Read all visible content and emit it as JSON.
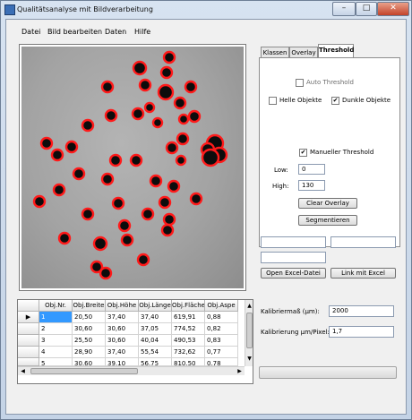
{
  "window": {
    "title": "Qualitätsanalyse mit Bildverarbeitung",
    "minimize_glyph": "–",
    "maximize_glyph": "□",
    "close_glyph": "✕"
  },
  "menu": [
    "Datei",
    "Bild bearbeiten",
    "Daten",
    "Hilfe"
  ],
  "tabs": [
    "Klassen",
    "Overlay",
    "Threshold"
  ],
  "threshold_panel": {
    "auto_threshold": {
      "label": "Auto Threshold",
      "checked": false
    },
    "helle_objekte": {
      "label": "Helle Objekte",
      "checked": false
    },
    "dunkle_objekte": {
      "label": "Dunkle Objekte",
      "checked": true
    },
    "manueller_threshold": {
      "label": "Manueller Threshold",
      "checked": true
    },
    "low_label": "Low:",
    "low_value": "0",
    "high_label": "High:",
    "high_value": "130",
    "clear_overlay_button": "Clear Overlay",
    "segmentieren_button": "Segmentieren"
  },
  "fields": {
    "field1": "",
    "field2": "",
    "field3": ""
  },
  "buttons": {
    "open_excel": "Open Excel-Datei",
    "link_excel": "Link mit Excel"
  },
  "calibration": {
    "kalibriermass_label": "Kalibriermaß (µm):",
    "kalibriermass_value": "2000",
    "kalibrierung_label": "Kalibrierung µm/Pixel:",
    "kalibrierung_value": "1,7"
  },
  "table": {
    "columns": [
      "Obj.Nr.",
      "Obj.Breite",
      "Obj.Höhe",
      "Obj.Länge",
      "Obj.Fläche",
      "Obj.Aspe"
    ],
    "rows": [
      [
        "1",
        "20,50",
        "37,40",
        "37,40",
        "619,91",
        "0,88"
      ],
      [
        "2",
        "30,60",
        "30,60",
        "37,05",
        "774,52",
        "0,82"
      ],
      [
        "3",
        "25,50",
        "30,60",
        "40,04",
        "490,53",
        "0,83"
      ],
      [
        "4",
        "28,90",
        "37,40",
        "55,54",
        "732,62",
        "0,77"
      ],
      [
        "5",
        "30,60",
        "39,10",
        "56,75",
        "810,50",
        "0,78"
      ]
    ],
    "selected_row": 0,
    "current_row_marker": "▶"
  },
  "progress": {
    "value": 0
  },
  "colors": {
    "outline": "#ff1a1a",
    "selection": "#3399ff",
    "particle": "#0c0c0c"
  }
}
